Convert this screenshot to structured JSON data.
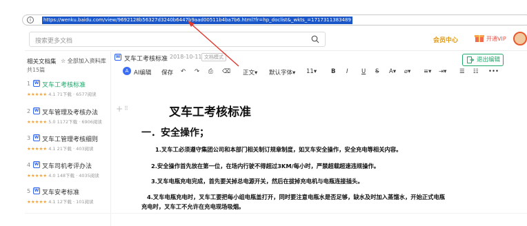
{
  "browser": {
    "url": "https://wenku.baidu.com/view/9692128b56327d3240b6447b9aad00511b4ba7b6.html?fr=hp_doclist&_wkts_=1717311383489"
  },
  "header": {
    "search_placeholder": "搜索更多文档",
    "member_center": "会员中心",
    "vip_label": "开通VIP"
  },
  "sidebar": {
    "heading": "相关文档集",
    "add_all": "☆ 全部加入资料库",
    "count": "共15篇",
    "items": [
      {
        "num": "1",
        "title": "叉车工考核标准",
        "rating": "★★★★★",
        "meta": "4.1  71下载 · 6577阅读"
      },
      {
        "num": "2",
        "title": "叉车管理及考核办法",
        "rating": "★★★★★",
        "meta": "5.0  1172下载 · 6906阅读"
      },
      {
        "num": "3",
        "title": "叉车工管理考核细则",
        "rating": "★★★★★",
        "meta": "4.1  21下载 · 403阅读"
      },
      {
        "num": "4",
        "title": "叉车司机考评办法",
        "rating": "★★★★★",
        "meta": "4.0  148下载 · 4035阅读"
      },
      {
        "num": "5",
        "title": "叉车安考标准",
        "rating": "★★★★★",
        "meta": "4.1  12下载 · 101阅读"
      }
    ]
  },
  "doc_header": {
    "title": "叉车工考核标准",
    "date": "2018-10-11",
    "badge": "文档模式",
    "exit_label": "退出编辑"
  },
  "toolbar": {
    "ai": "AI编辑",
    "save": "保存",
    "body_style": "正文",
    "font": "默认字体",
    "size": "11"
  },
  "content": {
    "h1": "叉车工考核标准",
    "h2": "一．安全操作；",
    "p1": "1.叉车工必须遵守集团公司和本部门相关制订规章制度，如叉车安全操作，安全充电等相关内容。",
    "p2": "2.安全操作首先放在第一位，在场内行驶不得超过3KM/每小时，严禁超载超速违规操作。",
    "p3": "3.叉车电瓶充电完成，首先要关掉总电源开关，然后在拔掉充电机与电瓶连接插头。",
    "p4a": "4.叉车电瓶充电时，叉车工要把每小组电瓶盖打开，同时要注意电瓶水是否足够，缺水及时加入蒸馏水，开始正式电瓶",
    "p4b": "充电时，叉车工不允许在充电现场吸烟。"
  },
  "colors": {
    "accent_green": "#1fa86a",
    "link_blue": "#2c5ff0",
    "member_orange": "#e29a15",
    "arrow_red": "#e03a2f"
  }
}
